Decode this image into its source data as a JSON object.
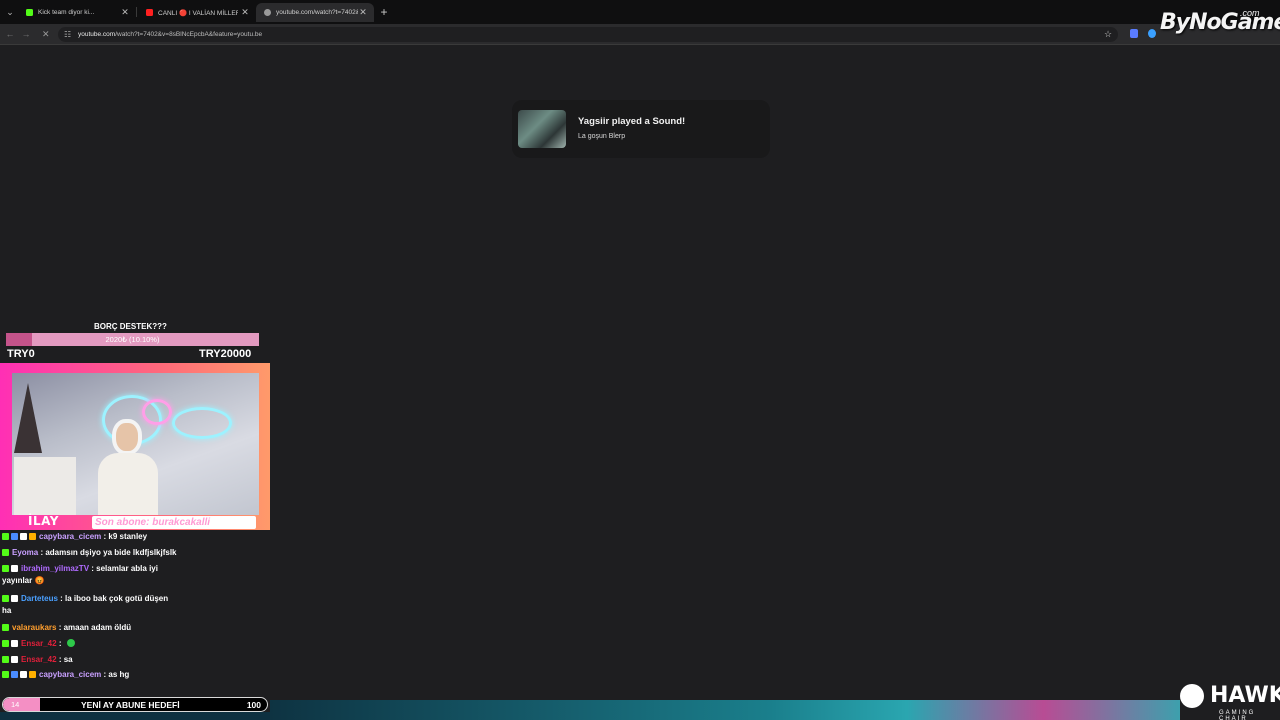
{
  "browser": {
    "tabs": [
      {
        "title": "Kick team diyor ki...",
        "favicon_color": "#53fc18"
      },
      {
        "title": "CANLI 🔴 I VALİAN MİLLER I #",
        "favicon_color": "#ff2020"
      },
      {
        "title": "youtube.com/watch?t=7402&v",
        "favicon_color": "#9a9a9a"
      }
    ],
    "url_host": "youtube.com",
    "url_path": "/watch?t=7402&v=8sBlNcEpcbA&feature=youtu.be"
  },
  "watermark": {
    "brand": "ByNoGame",
    "brand_sup": ".com"
  },
  "notification": {
    "title": "Yagsiir played a Sound!",
    "subtitle": "La goşun Blerp"
  },
  "donation_goal": {
    "title": "BORÇ DESTEK???",
    "progress_text": "2020₺ (10.10%)",
    "progress_fraction": 0.101,
    "min_label": "TRY0",
    "max_label": "TRY20000",
    "fill_color": "#c4538a",
    "bar_color": "#e39ac0"
  },
  "webcam": {
    "streamer_name": "İLAY",
    "latest_sub_text": "Son abone: burakcakalli"
  },
  "chat": [
    {
      "user": "capybara_cicem",
      "message": ": k9 stanley",
      "color": "#c9a0ff",
      "badges": [
        "#53fc18",
        "#4a8cff",
        "#ffffff",
        "#ffb000"
      ]
    },
    {
      "user": "Eyoma",
      "message": ": adamsın dşiyo ya bide lkdfjslkjfslk",
      "color": "#c9a0ff",
      "badges": [
        "#53fc18"
      ]
    },
    {
      "user": "ibrahim_yilmazTV",
      "message": ": selamlar abla iyi",
      "color": "#b06bff",
      "badges": [
        "#53fc18",
        "#ffffff"
      ]
    },
    {
      "user": "",
      "message": "yayınlar 😡",
      "color": "#ffffff",
      "badges": []
    },
    {
      "user": "Darteteus",
      "message": ": la iboo bak çok gotü düşen",
      "color": "#4aa0ff",
      "badges": [
        "#53fc18",
        "#ffffff"
      ]
    },
    {
      "user": "",
      "message": "ha",
      "color": "#ffffff",
      "badges": []
    },
    {
      "user": "valaraukars",
      "message": ": amaan adam öldü",
      "color": "#ff9f2e",
      "badges": [
        "#53fc18"
      ]
    },
    {
      "user": "Ensar_42",
      "message": ": ",
      "color": "#e0203a",
      "badges": [
        "#53fc18",
        "#ffffff"
      ],
      "emote_color": "#2ec94a"
    },
    {
      "user": "Ensar_42",
      "message": ": sa",
      "color": "#e0203a",
      "badges": [
        "#53fc18",
        "#ffffff"
      ]
    },
    {
      "user": "capybara_cicem",
      "message": ": as hg",
      "color": "#c9a0ff",
      "badges": [
        "#53fc18",
        "#4a8cff",
        "#ffffff",
        "#ffb000"
      ]
    }
  ],
  "sub_goal": {
    "current": "14",
    "label": "YENİ AY ABUNE HEDEFİ",
    "target": "100",
    "fraction": 0.14
  },
  "sponsor": {
    "name": "HAWK",
    "tagline": "GAMING CHAIR"
  }
}
